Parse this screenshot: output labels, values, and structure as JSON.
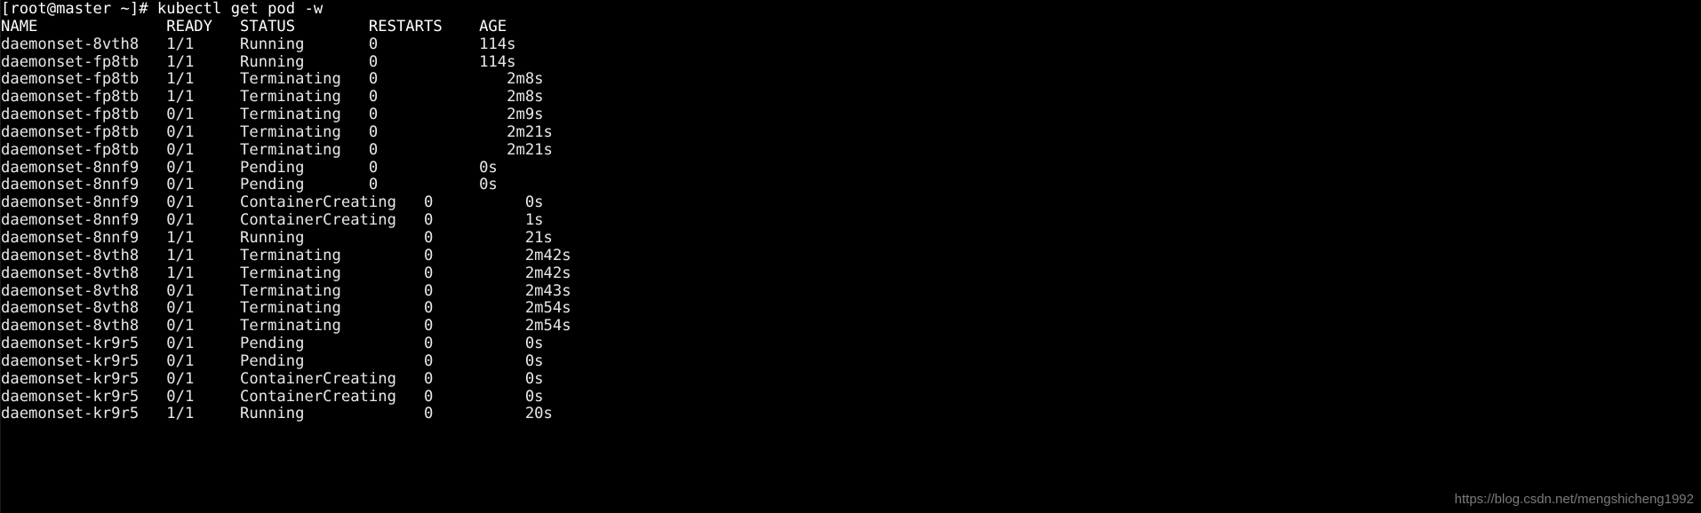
{
  "terminal": {
    "title": "kubectl get pod -w",
    "background_color": "#000000",
    "foreground_color": "#e8e8e8",
    "prompt": "[root@master ~]# kubectl get pod -w",
    "columns": {
      "name": "NAME",
      "ready": "READY",
      "status": "STATUS",
      "restarts": "RESTARTS",
      "age": "AGE"
    },
    "header_line": "NAME              READY   STATUS        RESTARTS    AGE",
    "lines": [
      "[root@master ~]# kubectl get pod -w",
      "NAME              READY   STATUS        RESTARTS    AGE",
      "daemonset-8vth8   1/1     Running       0           114s",
      "daemonset-fp8tb   1/1     Running       0           114s",
      "daemonset-fp8tb   1/1     Terminating   0              2m8s",
      "daemonset-fp8tb   1/1     Terminating   0              2m8s",
      "daemonset-fp8tb   0/1     Terminating   0              2m9s",
      "daemonset-fp8tb   0/1     Terminating   0              2m21s",
      "daemonset-fp8tb   0/1     Terminating   0              2m21s",
      "daemonset-8nnf9   0/1     Pending       0           0s",
      "daemonset-8nnf9   0/1     Pending       0           0s",
      "daemonset-8nnf9   0/1     ContainerCreating   0          0s",
      "daemonset-8nnf9   0/1     ContainerCreating   0          1s",
      "daemonset-8nnf9   1/1     Running             0          21s",
      "daemonset-8vth8   1/1     Terminating         0          2m42s",
      "daemonset-8vth8   1/1     Terminating         0          2m42s",
      "daemonset-8vth8   0/1     Terminating         0          2m43s",
      "daemonset-8vth8   0/1     Terminating         0          2m54s",
      "daemonset-8vth8   0/1     Terminating         0          2m54s",
      "daemonset-kr9r5   0/1     Pending             0          0s",
      "daemonset-kr9r5   0/1     Pending             0          0s",
      "daemonset-kr9r5   0/1     ContainerCreating   0          0s",
      "daemonset-kr9r5   0/1     ContainerCreating   0          0s",
      "daemonset-kr9r5   1/1     Running             0          20s"
    ],
    "rows": [
      {
        "name": "daemonset-8vth8",
        "ready": "1/1",
        "status": "Running",
        "restarts": "0",
        "age": "114s"
      },
      {
        "name": "daemonset-fp8tb",
        "ready": "1/1",
        "status": "Running",
        "restarts": "0",
        "age": "114s"
      },
      {
        "name": "daemonset-fp8tb",
        "ready": "1/1",
        "status": "Terminating",
        "restarts": "0",
        "age": "2m8s"
      },
      {
        "name": "daemonset-fp8tb",
        "ready": "1/1",
        "status": "Terminating",
        "restarts": "0",
        "age": "2m8s"
      },
      {
        "name": "daemonset-fp8tb",
        "ready": "0/1",
        "status": "Terminating",
        "restarts": "0",
        "age": "2m9s"
      },
      {
        "name": "daemonset-fp8tb",
        "ready": "0/1",
        "status": "Terminating",
        "restarts": "0",
        "age": "2m21s"
      },
      {
        "name": "daemonset-fp8tb",
        "ready": "0/1",
        "status": "Terminating",
        "restarts": "0",
        "age": "2m21s"
      },
      {
        "name": "daemonset-8nnf9",
        "ready": "0/1",
        "status": "Pending",
        "restarts": "0",
        "age": "0s"
      },
      {
        "name": "daemonset-8nnf9",
        "ready": "0/1",
        "status": "Pending",
        "restarts": "0",
        "age": "0s"
      },
      {
        "name": "daemonset-8nnf9",
        "ready": "0/1",
        "status": "ContainerCreating",
        "restarts": "0",
        "age": "0s"
      },
      {
        "name": "daemonset-8nnf9",
        "ready": "0/1",
        "status": "ContainerCreating",
        "restarts": "0",
        "age": "1s"
      },
      {
        "name": "daemonset-8nnf9",
        "ready": "1/1",
        "status": "Running",
        "restarts": "0",
        "age": "21s"
      },
      {
        "name": "daemonset-8vth8",
        "ready": "1/1",
        "status": "Terminating",
        "restarts": "0",
        "age": "2m42s"
      },
      {
        "name": "daemonset-8vth8",
        "ready": "1/1",
        "status": "Terminating",
        "restarts": "0",
        "age": "2m42s"
      },
      {
        "name": "daemonset-8vth8",
        "ready": "0/1",
        "status": "Terminating",
        "restarts": "0",
        "age": "2m43s"
      },
      {
        "name": "daemonset-8vth8",
        "ready": "0/1",
        "status": "Terminating",
        "restarts": "0",
        "age": "2m54s"
      },
      {
        "name": "daemonset-8vth8",
        "ready": "0/1",
        "status": "Terminating",
        "restarts": "0",
        "age": "2m54s"
      },
      {
        "name": "daemonset-kr9r5",
        "ready": "0/1",
        "status": "Pending",
        "restarts": "0",
        "age": "0s"
      },
      {
        "name": "daemonset-kr9r5",
        "ready": "0/1",
        "status": "Pending",
        "restarts": "0",
        "age": "0s"
      },
      {
        "name": "daemonset-kr9r5",
        "ready": "0/1",
        "status": "ContainerCreating",
        "restarts": "0",
        "age": "0s"
      },
      {
        "name": "daemonset-kr9r5",
        "ready": "0/1",
        "status": "ContainerCreating",
        "restarts": "0",
        "age": "0s"
      },
      {
        "name": "daemonset-kr9r5",
        "ready": "1/1",
        "status": "Running",
        "restarts": "0",
        "age": "20s"
      }
    ]
  },
  "watermark": {
    "text": "https://blog.csdn.net/mengshicheng1992",
    "color": "#7a7a7a"
  }
}
